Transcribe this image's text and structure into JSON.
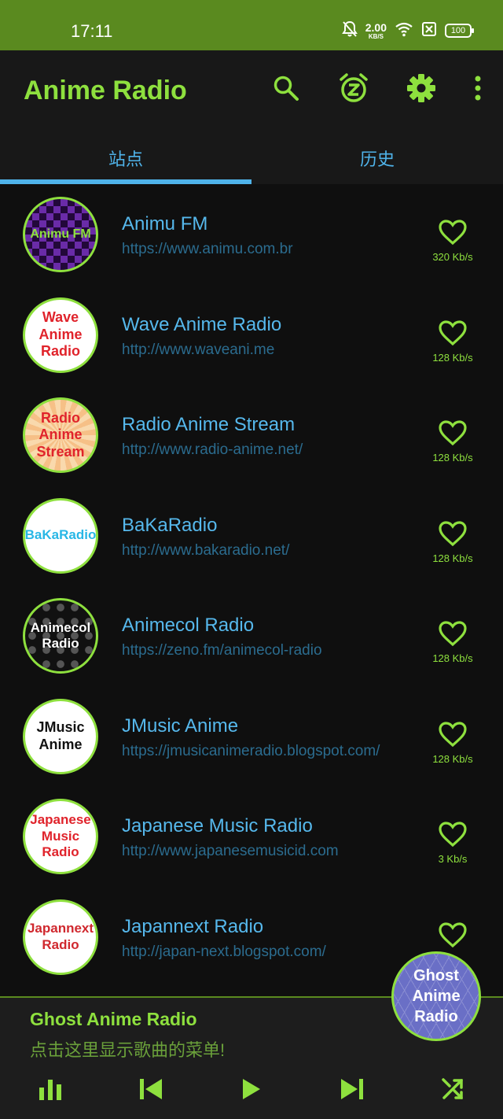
{
  "status": {
    "time": "17:11",
    "net_speed": "2.00",
    "net_unit": "KB/S",
    "battery": "100"
  },
  "app": {
    "title": "Anime Radio",
    "actions": [
      "search-icon",
      "sleep-timer-icon",
      "settings-icon",
      "more-vert-icon"
    ]
  },
  "tabs": [
    {
      "label": "站点",
      "active": true
    },
    {
      "label": "历史",
      "active": false
    }
  ],
  "stations": [
    {
      "logo_text": "Animu FM",
      "name": "Animu FM",
      "url": "https://www.animu.com.br",
      "bitrate": "320 Kb/s"
    },
    {
      "logo_text": "Wave Anime Radio",
      "name": "Wave Anime Radio",
      "url": "http://www.waveani.me",
      "bitrate": "128 Kb/s"
    },
    {
      "logo_text": "Radio Anime Stream",
      "name": "Radio Anime Stream",
      "url": "http://www.radio-anime.net/",
      "bitrate": "128 Kb/s"
    },
    {
      "logo_text": "BaKaRadio",
      "name": "BaKaRadio",
      "url": "http://www.bakaradio.net/",
      "bitrate": "128 Kb/s"
    },
    {
      "logo_text": "Animecol Radio",
      "name": "Animecol Radio",
      "url": "https://zeno.fm/animecol-radio",
      "bitrate": "128 Kb/s"
    },
    {
      "logo_text": "JMusic Anime",
      "name": "JMusic Anime",
      "url": "https://jmusicanimeradio.blogspot.com/",
      "bitrate": "128 Kb/s"
    },
    {
      "logo_text": "Japanese Music Radio",
      "name": "Japanese Music Radio",
      "url": "http://www.japanesemusicid.com",
      "bitrate": "3 Kb/s"
    },
    {
      "logo_text": "Japannext Radio",
      "name": "Japannext Radio",
      "url": "http://japan-next.blogspot.com/",
      "bitrate": ""
    }
  ],
  "player": {
    "title": "Ghost Anime Radio",
    "subtitle": "点击这里显示歌曲的菜单!",
    "art_text": "Ghost Anime Radio",
    "controls": [
      "equalizer-icon",
      "skip-previous-icon",
      "play-icon",
      "skip-next-icon",
      "shuffle-icon"
    ]
  },
  "colors": {
    "accent_green": "#8ee03e",
    "status_bar": "#5a8a1f",
    "link_blue": "#56b8ec",
    "url_blue": "#2b6c8f",
    "background": "#0f0f0f"
  }
}
